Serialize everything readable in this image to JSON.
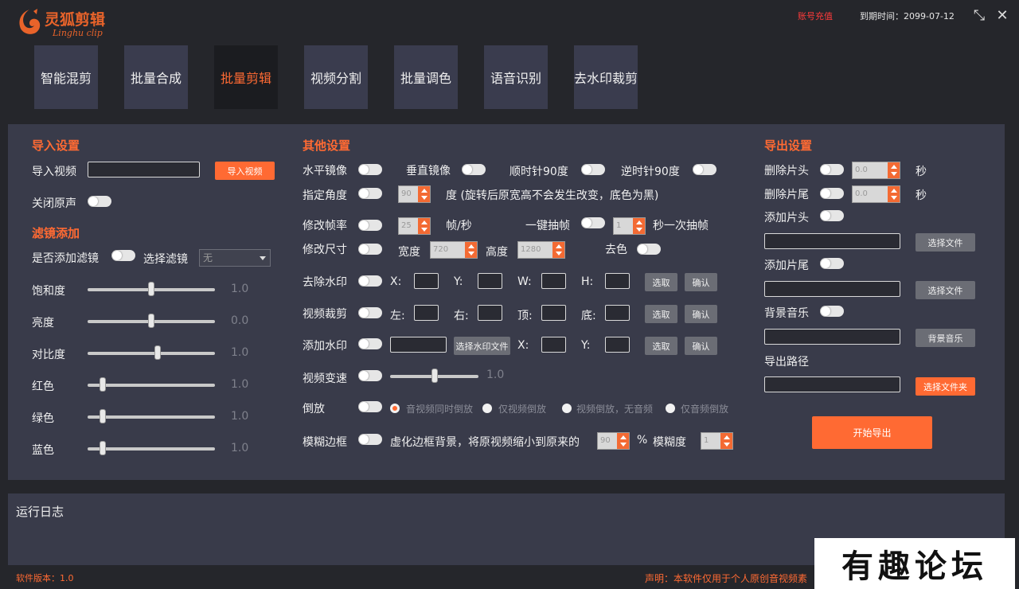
{
  "app": {
    "name_cn": "灵狐剪辑",
    "name_en": "Linghu clip",
    "recharge": "账号充值",
    "expiry": "到期时间：2099-07-12"
  },
  "tabs": [
    {
      "label": "智能混剪",
      "active": false
    },
    {
      "label": "批量合成",
      "active": false
    },
    {
      "label": "批量剪辑",
      "active": true
    },
    {
      "label": "视频分割",
      "active": false
    },
    {
      "label": "批量调色",
      "active": false
    },
    {
      "label": "语音识别",
      "active": false
    },
    {
      "label": "去水印裁剪",
      "active": false
    }
  ],
  "import": {
    "title": "导入设置",
    "video_label": "导入视频",
    "video_button": "导入视频",
    "mute_label": "关闭原声"
  },
  "filter": {
    "title": "滤镜添加",
    "add_label": "是否添加滤镜",
    "choose_label": "选择滤镜",
    "choose_value": "无",
    "sliders": [
      {
        "label": "饱和度",
        "value": "1.0",
        "level": 0.5
      },
      {
        "label": "亮度",
        "value": "0.0",
        "level": 0.5
      },
      {
        "label": "对比度",
        "value": "1.0",
        "level": 0.55
      },
      {
        "label": "红色",
        "value": "1.0",
        "level": 0.12
      },
      {
        "label": "绿色",
        "value": "1.0",
        "level": 0.12
      },
      {
        "label": "蓝色",
        "value": "1.0",
        "level": 0.12
      }
    ]
  },
  "other": {
    "title": "其他设置",
    "h_mirror": "水平镜像",
    "v_mirror": "垂直镜像",
    "cw90": "顺时针90度",
    "ccw90": "逆时针90度",
    "angle_label": "指定角度",
    "angle_value": "90",
    "angle_note": "度 (旋转后原宽高不会发生改变，底色为黑)",
    "fps_label": "修改帧率",
    "fps_value": "25",
    "fps_unit": "帧/秒",
    "extract_label": "一键抽帧",
    "extract_value": "1",
    "extract_unit": "秒一次抽帧",
    "size_label": "修改尺寸",
    "width_label": "宽度",
    "width_value": "720",
    "height_label": "高度",
    "height_value": "1280",
    "decolor_label": "去色",
    "remove_wm_label": "去除水印",
    "x_label": "X:",
    "y_label": "Y:",
    "w_label": "W:",
    "h_label": "H:",
    "pick_btn": "选取",
    "confirm_btn": "确认",
    "crop_label": "视频裁剪",
    "left_label": "左:",
    "right_label": "右:",
    "top_label": "顶:",
    "bottom_label": "底:",
    "add_wm_label": "添加水印",
    "choose_wm_btn": "选择水印文件",
    "speed_label": "视频变速",
    "speed_value": "1.0",
    "speed_level": 0.5,
    "reverse_label": "倒放",
    "reverse_opts": [
      "音视频同时倒放",
      "仅视频倒放",
      "视频倒放，无音频",
      "仅音频倒放"
    ],
    "blur_label": "模糊边框",
    "blur_text": "虚化边框背景，将原视频缩小到原来的",
    "blur_scale": "90",
    "blur_percent": "%",
    "blur_degree_label": "模糊度",
    "blur_degree": "1"
  },
  "export": {
    "title": "导出设置",
    "del_head": "删除片头",
    "del_head_value": "0.0",
    "del_tail": "删除片尾",
    "del_tail_value": "0.0",
    "sec": "秒",
    "add_head": "添加片头",
    "add_tail": "添加片尾",
    "choose_file": "选择文件",
    "bgm": "背景音乐",
    "bgm_btn": "背景音乐",
    "path": "导出路径",
    "choose_folder": "选择文件夹",
    "start": "开始导出"
  },
  "log": {
    "title": "运行日志"
  },
  "footer": {
    "version": "软件版本：1.0",
    "disclaimer": "声明：本软件仅用于个人原创音视频素"
  },
  "watermark": "有趣论坛",
  "colors": {
    "accent": "#ff6a33",
    "panel": "#393b4a",
    "bg": "#25262b"
  }
}
